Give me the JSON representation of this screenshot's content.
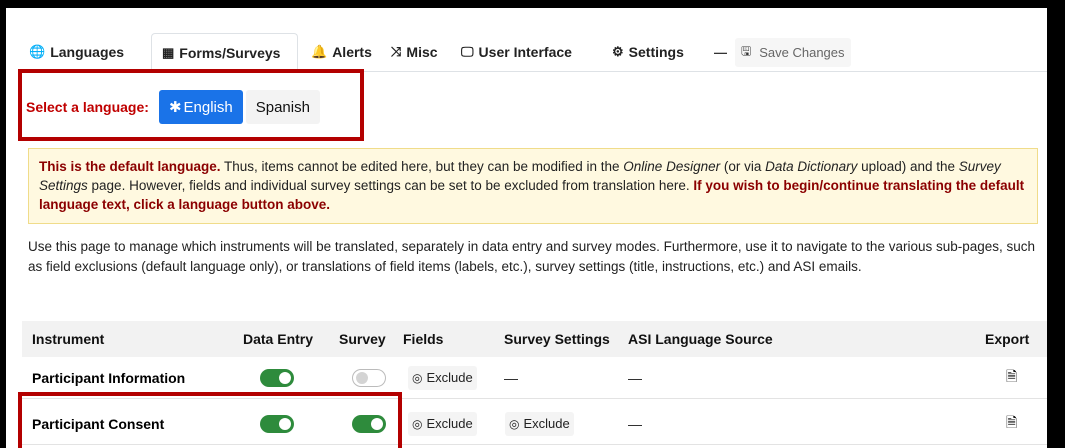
{
  "tabs": [
    {
      "label": "Languages",
      "icon": "globe-icon"
    },
    {
      "label": "Forms/Surveys",
      "icon": "table-icon"
    },
    {
      "label": "Alerts",
      "icon": "bell-icon"
    },
    {
      "label": "Misc",
      "icon": "shuffle-icon"
    },
    {
      "label": "User Interface",
      "icon": "desktop-icon"
    },
    {
      "label": "Settings",
      "icon": "cog-icon"
    }
  ],
  "save": {
    "dash": "—",
    "label": "Save Changes"
  },
  "language_select": {
    "label": "Select a language:",
    "active": "English",
    "active_prefix": "✱",
    "other": "Spanish"
  },
  "alert": {
    "b1": "This is the default language.",
    "t1": " Thus, items cannot be edited here, but they can be modified in the ",
    "i1": "Online Designer",
    "t2": " (or via ",
    "i2": "Data Dictionary",
    "t3": " upload) and the ",
    "i3": "Survey Settings",
    "t4": " page. However, fields and individual survey settings can be set to be excluded from translation here. ",
    "b2": "If you wish to begin/continue translating the default language text, click a language button above."
  },
  "intro": "Use this page to manage which instruments will be translated, separately in data entry and survey modes. Furthermore, use it to navigate to the various sub-pages, such as field exclusions (default language only), or translations of field items (labels, etc.), survey settings (title, instructions, etc.) and ASI emails.",
  "table": {
    "headers": {
      "instrument": "Instrument",
      "data_entry": "Data Entry",
      "survey": "Survey",
      "fields": "Fields",
      "survey_settings": "Survey Settings",
      "asi": "ASI Language Source",
      "export": "Export"
    },
    "rows": [
      {
        "name": "Participant Information",
        "data_entry_on": true,
        "survey_on": false,
        "fields": "Exclude",
        "survey_settings": "—",
        "asi": "—"
      },
      {
        "name": "Participant Consent",
        "data_entry_on": true,
        "survey_on": true,
        "fields": "Exclude",
        "survey_settings": "Exclude",
        "asi": "—"
      }
    ]
  },
  "colors": {
    "accent": "#1a73e8",
    "danger": "#c00000",
    "toggle_on": "#2e8b3c",
    "highlight": "#b30000"
  }
}
